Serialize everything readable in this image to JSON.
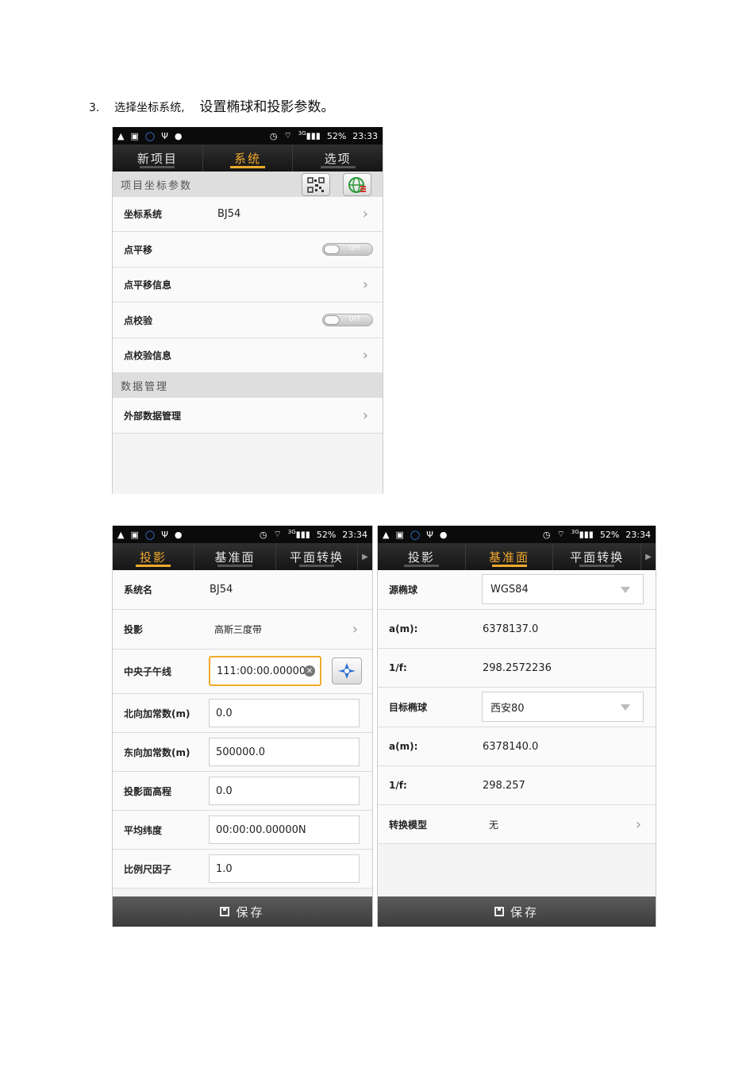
{
  "step": {
    "number": "3.",
    "text_a": "选择坐标系统,",
    "text_b": "设置椭球和投影参数。"
  },
  "status_bar": {
    "signal_label": "3G",
    "battery": "52%",
    "time1": "23:33",
    "time2": "23:34"
  },
  "screen1": {
    "tabs": [
      "新项目",
      "系统",
      "选项"
    ],
    "active_tab": 1,
    "section1_title": "项目坐标参数",
    "rows": [
      {
        "label": "坐标系统",
        "value": "BJ54"
      },
      {
        "label": "点平移",
        "toggle": "OFF"
      },
      {
        "label": "点平移信息"
      },
      {
        "label": "点校验",
        "toggle": "OFF"
      },
      {
        "label": "点校验信息"
      }
    ],
    "section2_title": "数据管理",
    "data_row": "外部数据管理"
  },
  "screen2": {
    "tabs": [
      "投影",
      "基准面",
      "平面转换"
    ],
    "active_tab": 0,
    "system_name_label": "系统名",
    "system_name": "BJ54",
    "projection_label": "投影",
    "projection_value": "高斯三度带",
    "fields": [
      {
        "label": "中央子午线",
        "value": "111:00:00.00000"
      },
      {
        "label": "北向加常数(m)",
        "value": "0.0"
      },
      {
        "label": "东向加常数(m)",
        "value": "500000.0"
      },
      {
        "label": "投影面高程",
        "value": "0.0"
      },
      {
        "label": "平均纬度",
        "value": "00:00:00.00000N"
      },
      {
        "label": "比例尺因子",
        "value": "1.0"
      }
    ],
    "save_label": "保存"
  },
  "screen3": {
    "tabs": [
      "投影",
      "基准面",
      "平面转换"
    ],
    "active_tab": 1,
    "source_label": "源椭球",
    "source_value": "WGS84",
    "a1_label": "a(m):",
    "a1_value": "6378137.0",
    "f1_label": "1/f:",
    "f1_value": "298.2572236",
    "target_label": "目标椭球",
    "target_value": "西安80",
    "a2_label": "a(m):",
    "a2_value": "6378140.0",
    "f2_label": "1/f:",
    "f2_value": "298.257",
    "model_label": "转换模型",
    "model_value": "无",
    "save_label": "保存"
  },
  "colors": {
    "accent": "#f0a92c",
    "tabbar": "#1e1e1e",
    "savebar": "#4a4a4a"
  }
}
